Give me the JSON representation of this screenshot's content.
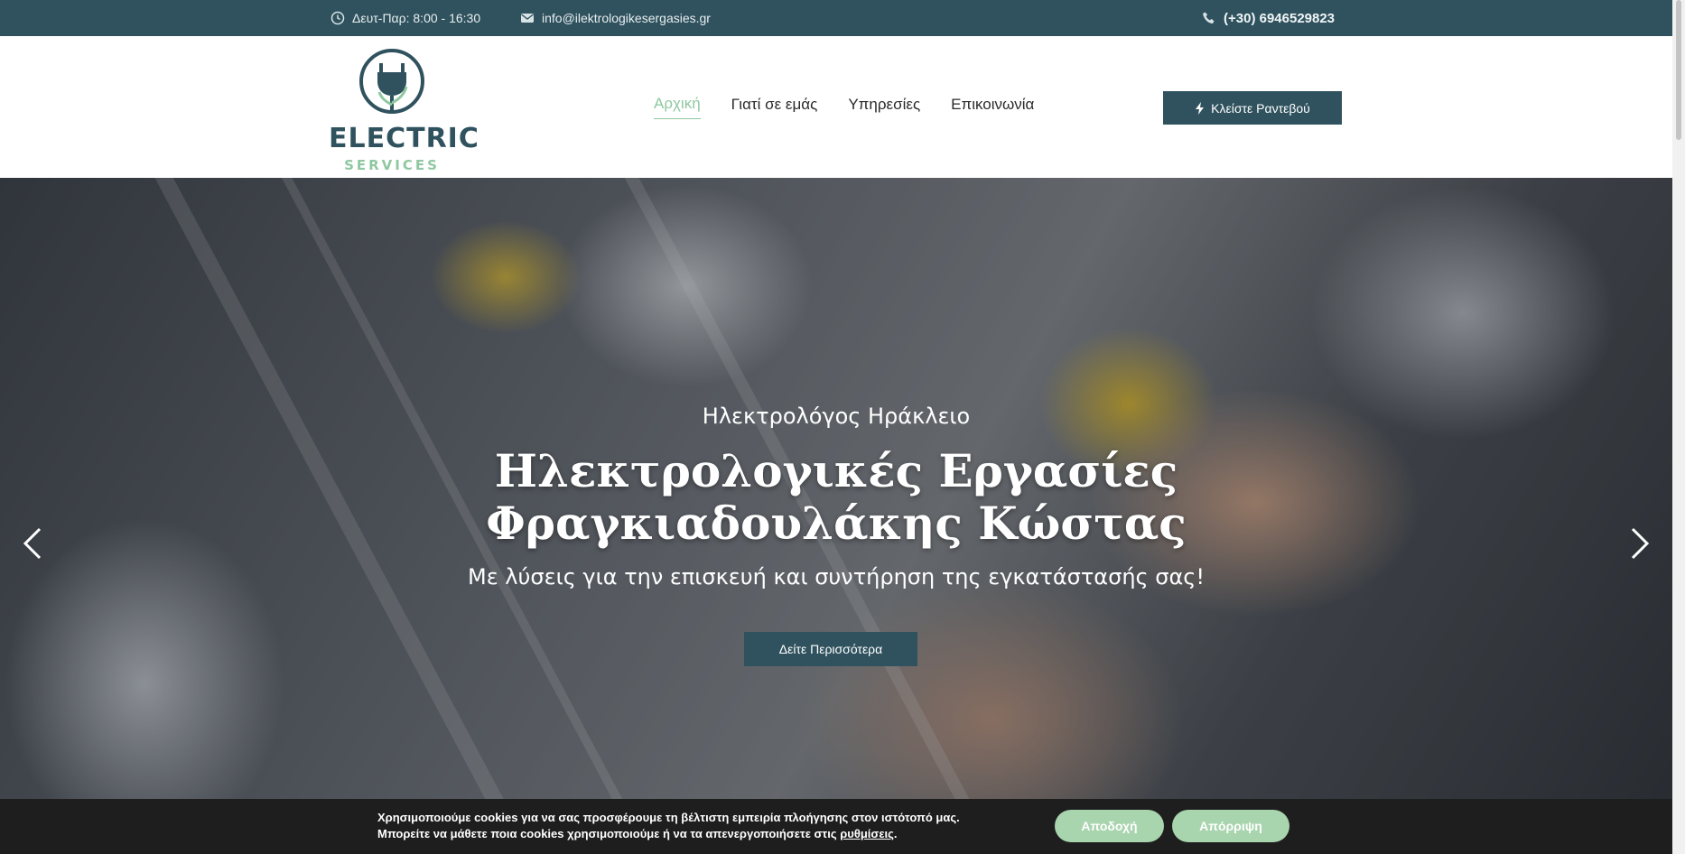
{
  "topbar": {
    "hours": "Δευτ-Παρ: 8:00 - 16:30",
    "email": "info@ilektrologikesergasies.gr",
    "phone": "(+30) 6946529823"
  },
  "header": {
    "logo_main": "ELECTRIC",
    "logo_sub": "SERVICES",
    "nav": [
      {
        "label": "Αρχική",
        "active": true
      },
      {
        "label": "Γιατί σε εμάς",
        "active": false
      },
      {
        "label": "Υπηρεσίες",
        "active": false
      },
      {
        "label": "Επικοινωνία",
        "active": false
      }
    ],
    "cta_label": "Κλείστε Ραντεβού"
  },
  "hero": {
    "kicker": "Ηλεκτρολόγος Ηράκλειο",
    "title_line1": "Ηλεκτρολογικές Εργασίες",
    "title_line2": "Φραγκιαδουλάκης Κώστας",
    "subtitle": "Με λύσεις για την επισκευή και συντήρηση της εγκατάστασής σας!",
    "button_label": "Δείτε Περισσότερα"
  },
  "cookie": {
    "line1": "Χρησιμοποιούμε cookies για να σας προσφέρουμε τη βέλτιστη εμπειρία πλοήγησης στον ιστότοπό μας.",
    "line2_prefix": "Μπορείτε να μάθετε ποια cookies χρησιμοποιούμε ή να τα απενεργοποιήσετε στις",
    "line2_link": "ρυθμίσεις",
    "accept_label": "Αποδοχή",
    "reject_label": "Απόρριψη"
  },
  "colors": {
    "primary": "#2f525e",
    "accent": "#8fc8a0",
    "cookie_button": "#a8d4ae"
  },
  "icons": {
    "clock": "clock-icon",
    "mail": "envelope-icon",
    "phone": "phone-icon",
    "bolt": "bolt-icon",
    "prev": "chevron-left-icon",
    "next": "chevron-right-icon"
  }
}
